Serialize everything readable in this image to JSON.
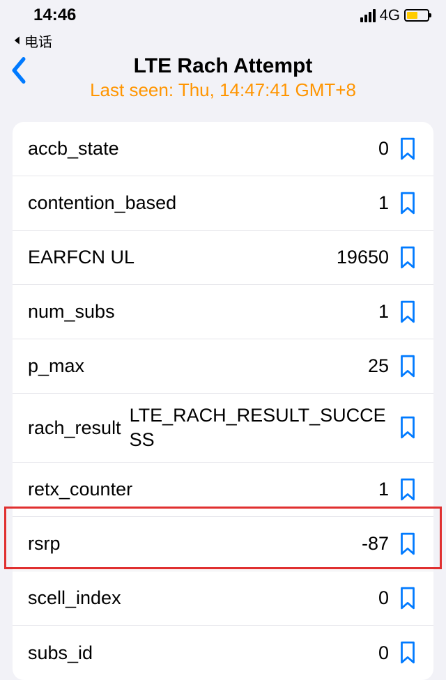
{
  "status": {
    "time": "14:46",
    "network": "4G"
  },
  "breadcrumb": {
    "label": "电话"
  },
  "header": {
    "title": "LTE Rach Attempt",
    "subtitle": "Last seen: Thu, 14:47:41 GMT+8"
  },
  "rows": [
    {
      "label": "accb_state",
      "value": "0"
    },
    {
      "label": "contention_based",
      "value": "1"
    },
    {
      "label": "EARFCN UL",
      "value": "19650"
    },
    {
      "label": "num_subs",
      "value": "1"
    },
    {
      "label": "p_max",
      "value": "25"
    },
    {
      "label": "rach_result",
      "value": "LTE_RACH_RESULT_SUCCESS"
    },
    {
      "label": "retx_counter",
      "value": "1"
    },
    {
      "label": "rsrp",
      "value": "-87"
    },
    {
      "label": "scell_index",
      "value": "0"
    },
    {
      "label": "subs_id",
      "value": "0"
    }
  ],
  "highlighted_row_index": 7
}
